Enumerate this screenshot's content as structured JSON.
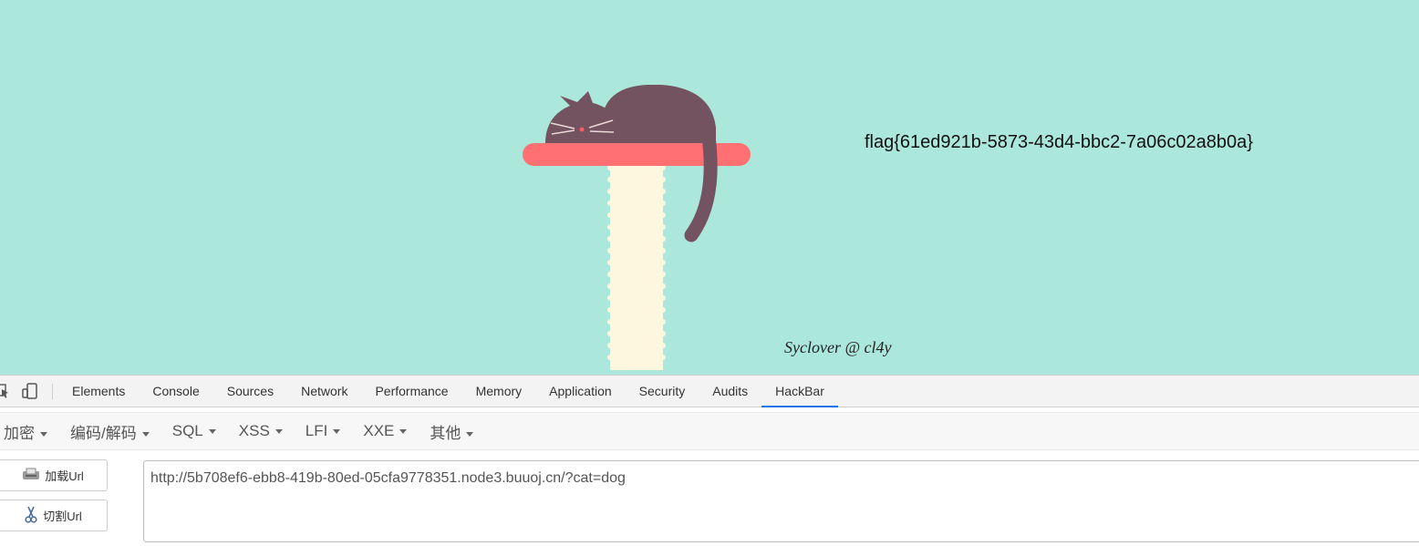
{
  "page": {
    "flag_text": "flag{61ed921b-5873-43d4-bbc2-7a06c02a8b0a}",
    "credit_text": "Syclover @ cl4y",
    "colors": {
      "background": "#abe7db",
      "cat": "#73535f",
      "shelf": "#ff7073",
      "post": "#fdf7df"
    }
  },
  "devtools": {
    "toolbar_icons": [
      "inspect-element-icon",
      "device-toolbar-icon"
    ],
    "tabs": [
      "Elements",
      "Console",
      "Sources",
      "Network",
      "Performance",
      "Memory",
      "Application",
      "Security",
      "Audits",
      "HackBar"
    ],
    "active_tab": "HackBar"
  },
  "hackbar": {
    "menus": [
      "加密",
      "编码/解码",
      "SQL",
      "XSS",
      "LFI",
      "XXE",
      "其他"
    ],
    "load_url_label": "加载Url",
    "split_url_label": "切割Url",
    "url_value": "http://5b708ef6-ebb8-419b-80ed-05cfa9778351.node3.buuoj.cn/?cat=dog"
  }
}
